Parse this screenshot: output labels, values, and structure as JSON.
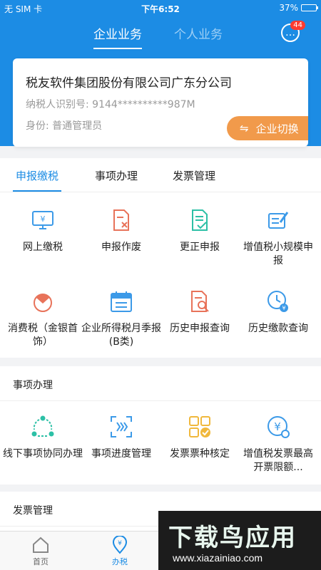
{
  "status_bar": {
    "carrier": "无 SIM 卡",
    "time": "下午6:52",
    "battery": "37%"
  },
  "top_tabs": {
    "enterprise": "企业业务",
    "personal": "个人业务"
  },
  "messages": {
    "count": "44"
  },
  "company": {
    "name": "税友软件集团股份有限公司广东分公司",
    "taxid": "纳税人识别号: 9144**********987M",
    "identity": "身份: 普通管理员",
    "switch_label": "企业切换"
  },
  "seg_tabs": [
    "申报缴税",
    "事项办理",
    "发票管理"
  ],
  "tax_items": [
    "网上缴税",
    "申报作废",
    "更正申报",
    "增值税小规模申报",
    "消费税（金银首饰）",
    "企业所得税月季报(B类)",
    "历史申报查询",
    "历史缴款查询"
  ],
  "affairs": {
    "title": "事项办理",
    "items": [
      "线下事项协同办理",
      "事项进度管理",
      "发票票种核定",
      "增值税发票最高开票限额..."
    ]
  },
  "invoice": {
    "title": "发票管理"
  },
  "bottom_nav": {
    "home": "首页",
    "tax": "办税"
  },
  "watermark": {
    "title": "下载鸟应用",
    "url": "www.xiazainiao.com"
  },
  "colors": {
    "primary": "#1c8ce4",
    "orange": "#f19a4b",
    "badge": "#ff3b30"
  },
  "icons": {
    "tax_items": [
      "monitor-yen-icon",
      "doc-cancel-icon",
      "doc-check-icon",
      "doc-edit-icon",
      "diamond-icon",
      "calendar-icon",
      "doc-search-icon",
      "clock-yen-icon"
    ],
    "affairs": [
      "share-nodes-icon",
      "scan-progress-icon",
      "grid-check-icon",
      "yen-circle-icon"
    ]
  }
}
